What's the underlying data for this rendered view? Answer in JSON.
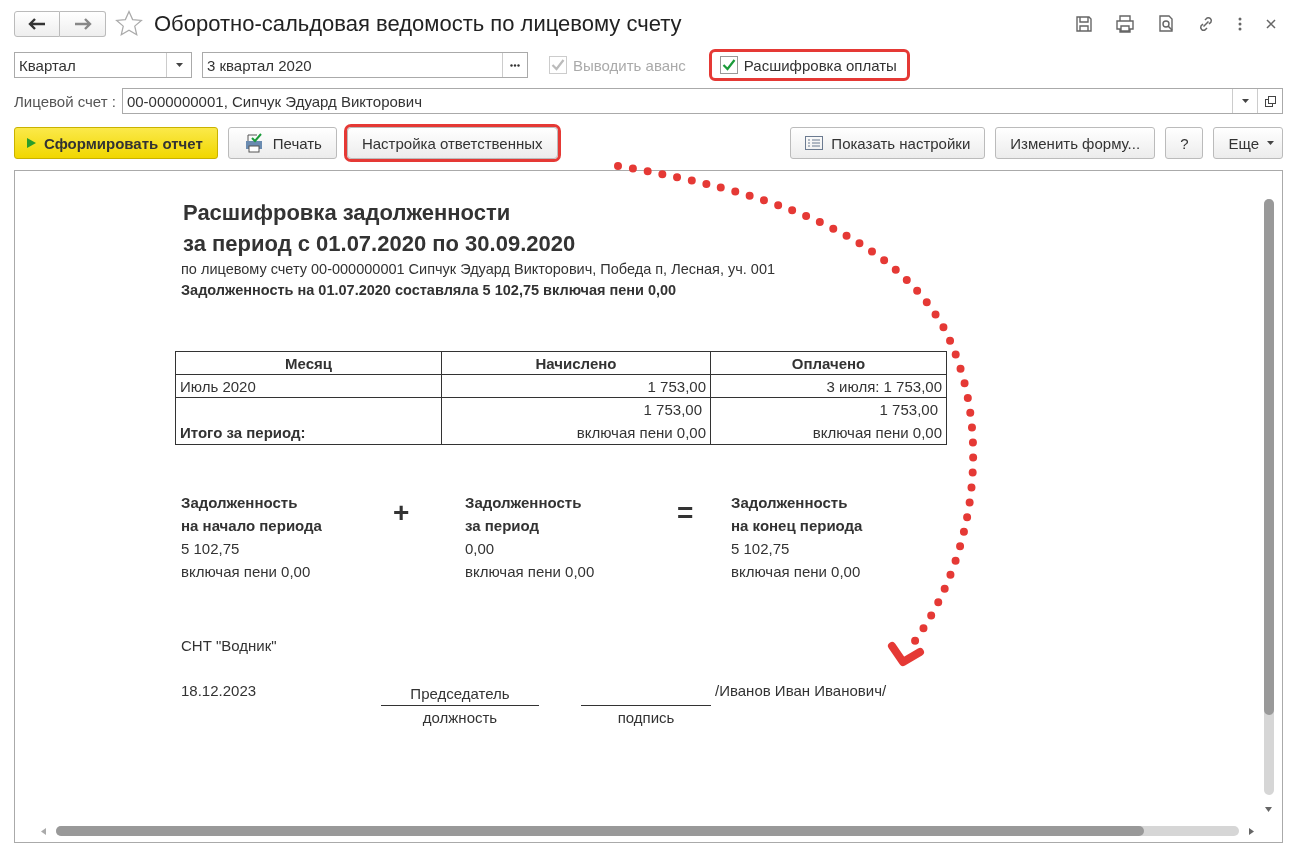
{
  "window": {
    "title": "Оборотно-сальдовая ведомость по лицевому счету",
    "favorite": false
  },
  "filters": {
    "period_type": "Квартал",
    "period": "3 квартал 2020",
    "options": [
      {
        "label": "Выводить аванс",
        "checked": true,
        "disabled": true,
        "highlighted": false
      },
      {
        "label": "Расшифровка оплаты",
        "checked": true,
        "disabled": false,
        "highlighted": true
      }
    ]
  },
  "account": {
    "label": "Лицевой счет :",
    "value": "00-000000001, Сипчук Эдуард Викторович"
  },
  "toolbar": [
    {
      "kind": "primary",
      "label": "Сформировать отчет",
      "highlighted": false
    },
    {
      "kind": "print",
      "label": "Печать",
      "highlighted": false
    },
    {
      "kind": "plain",
      "label": "Настройка ответственных",
      "highlighted": true
    },
    {
      "kind": "settings",
      "label": "Показать настройки",
      "highlighted": false
    },
    {
      "kind": "plain",
      "label": "Изменить форму...",
      "highlighted": false
    },
    {
      "kind": "plain",
      "label": "?",
      "highlighted": false
    },
    {
      "kind": "more",
      "label": "Еще",
      "highlighted": false
    }
  ],
  "report": {
    "heading": [
      "Расшифровка задолженности",
      "за период с 01.07.2020 по 30.09.2020"
    ],
    "subtitle": "по лицевому счету 00-000000001 Сипчук Эдуард Викторович, Победа п, Лесная, уч. 001",
    "opening_debt": "Задолженность на 01.07.2020 составляла 5 102,75 включая пени 0,00",
    "table": {
      "columns": [
        "Месяц",
        "Начислено",
        "Оплачено"
      ],
      "rows": [
        [
          "Июль 2020",
          "1 753,00",
          "3 июля: 1 753,00"
        ]
      ],
      "total": {
        "label": "Итого за период:",
        "accrued": "1 753,00",
        "accrued_penalty": "включая пени 0,00",
        "paid": "1 753,00",
        "paid_penalty": "включая пени 0,00"
      }
    },
    "summary": [
      {
        "title": [
          "Задолженность",
          "на начало периода"
        ],
        "value": "5 102,75",
        "penalty": "включая пени 0,00",
        "operator": "+"
      },
      {
        "title": [
          "Задолженность",
          "за период"
        ],
        "value": "0,00",
        "penalty": "включая пени 0,00",
        "operator": "="
      },
      {
        "title": [
          "Задолженность",
          "на конец периода"
        ],
        "value": "5 102,75",
        "penalty": "включая пени 0,00"
      }
    ],
    "organization": "СНТ \"Водник\"",
    "signature": {
      "date": "18.12.2023",
      "position": "Председатель",
      "position_caption": "должность",
      "signature_caption": "подпись",
      "name": "/Иванов Иван Иванович/"
    }
  }
}
